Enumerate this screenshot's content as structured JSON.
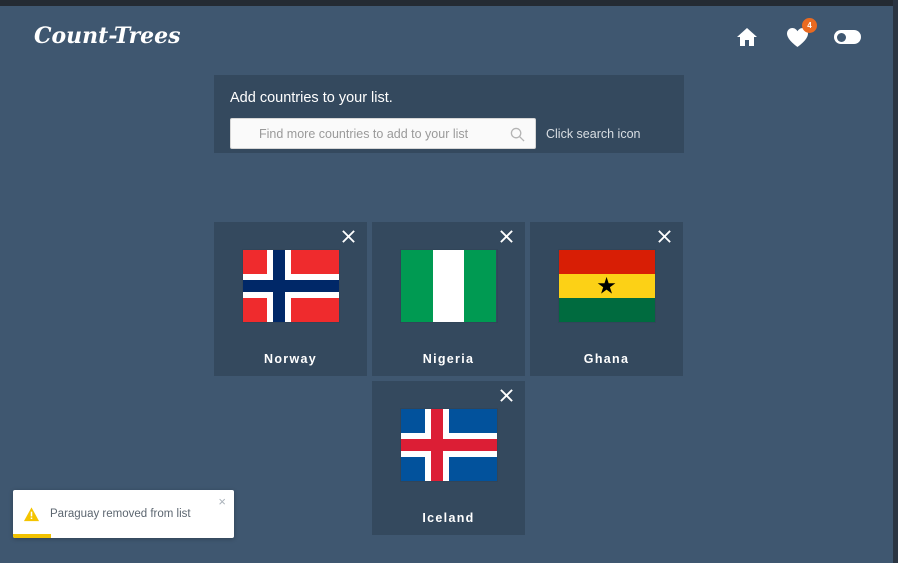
{
  "app": {
    "logo": "Count-Trees",
    "background_color": "#3F5770",
    "panel_color": "#34495E"
  },
  "header": {
    "icons": [
      {
        "name": "home-icon",
        "label": "Home"
      },
      {
        "name": "heart-icon",
        "label": "Favourites",
        "badge": "4",
        "badge_color": "#EA6A20"
      },
      {
        "name": "theme-toggle",
        "label": "Theme toggle",
        "state": "off"
      }
    ]
  },
  "search_panel": {
    "title": "Add countries to your list.",
    "input_value": "",
    "placeholder": "Find more countries to add to your list",
    "hint": "Click search icon",
    "search_icon": "search-icon"
  },
  "cards": [
    {
      "country": "Norway",
      "flag": "flag-norway",
      "close_label": "×"
    },
    {
      "country": "Nigeria",
      "flag": "flag-nigeria",
      "close_label": "×"
    },
    {
      "country": "Ghana",
      "flag": "flag-ghana",
      "close_label": "×"
    },
    {
      "country": "Iceland",
      "flag": "flag-iceland",
      "close_label": "×"
    }
  ],
  "toast": {
    "icon": "warning-triangle-icon",
    "message": "Paraguay removed from list",
    "close_label": "×",
    "progress_percent": 17,
    "progress_color": "#F2C200"
  }
}
